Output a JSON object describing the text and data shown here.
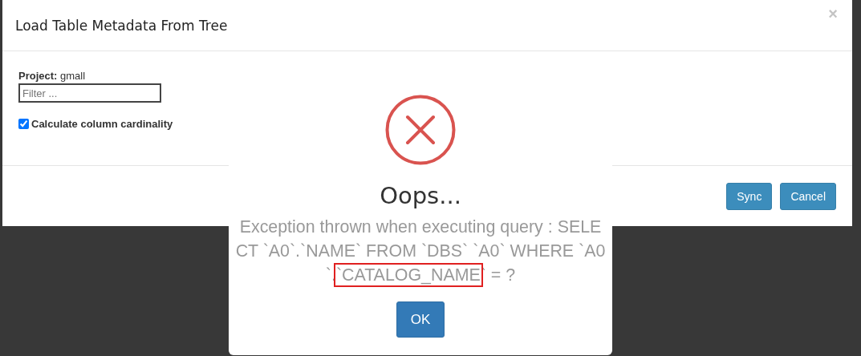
{
  "dialog": {
    "title": "Load Table Metadata From Tree",
    "close": "×",
    "project_label": "Project:",
    "project": "gmall",
    "filter": {
      "placeholder": "Filter ..."
    },
    "checkbox": {
      "label": "Calculate column cardinality",
      "checked": true
    },
    "buttons": [
      "Sync",
      "Cancel"
    ]
  },
  "alert": {
    "kind": "error",
    "title": "Oops...",
    "message": {
      "before": "Exception thrown when executing query : SELECT `A0`.`NAME` FROM `DBS` `A0` WHERE `A0`.",
      "highlighted": "`CATALOG_NAME",
      "after": "` = ?"
    },
    "button": "OK"
  }
}
